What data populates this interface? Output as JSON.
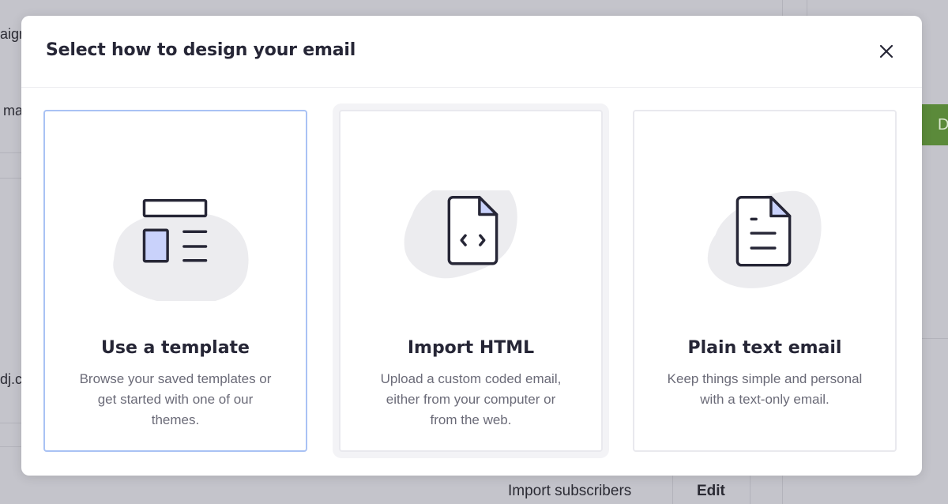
{
  "background": {
    "left_fragments": [
      "aign",
      "ma",
      "dj.c"
    ],
    "green_button_fragment": "D",
    "import_subscribers": "Import subscribers",
    "edit": "Edit"
  },
  "modal": {
    "title": "Select how to design your email",
    "close_icon": "close-icon"
  },
  "options": [
    {
      "title": "Use a template",
      "description": "Browse your saved templates or get started with one of our themes.",
      "icon": "template-layout-icon",
      "selected": true
    },
    {
      "title": "Import HTML",
      "description": "Upload a custom coded email, either from your computer or from the web.",
      "icon": "code-file-icon",
      "selected": false
    },
    {
      "title": "Plain text email",
      "description": "Keep things simple and personal with a text-only email.",
      "icon": "text-document-icon",
      "selected": false
    }
  ],
  "colors": {
    "icon_stroke": "#262636",
    "icon_fill_accent": "#c9d2fb",
    "blob": "#ececef",
    "selected_border": "#a9c2f4",
    "green_button": "#5b8a3a"
  }
}
